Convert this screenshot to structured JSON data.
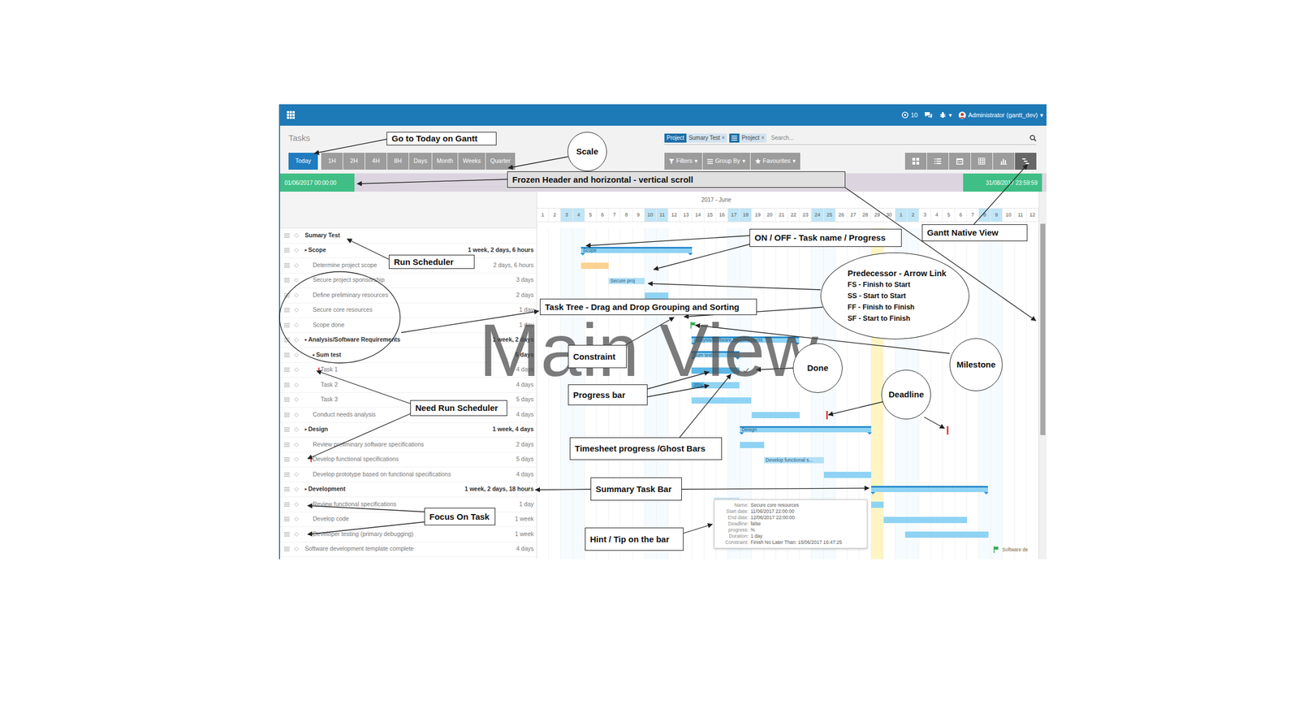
{
  "navbar": {
    "help_count": "10",
    "debug_caret": "▾",
    "user": "Administrator (gantt_dev)",
    "user_caret": "▾"
  },
  "control_panel": {
    "title": "Tasks",
    "facets": [
      {
        "kind": "field",
        "category": "Project",
        "value": "Sumary Test",
        "remove": "×"
      },
      {
        "kind": "groupby",
        "value": "Project",
        "remove": "×"
      }
    ],
    "search": {
      "placeholder": "Search..."
    },
    "today": "Today",
    "scales": [
      {
        "label": "1H",
        "selected": false
      },
      {
        "label": "2H",
        "selected": false
      },
      {
        "label": "4H",
        "selected": false
      },
      {
        "label": "8H",
        "selected": false
      },
      {
        "label": "Days",
        "selected": false
      },
      {
        "label": "Month",
        "selected": false
      },
      {
        "label": "Weeks",
        "selected": false
      },
      {
        "label": "Quarter",
        "selected": false
      }
    ],
    "filters": [
      {
        "kind": "filter",
        "label": "Filters",
        "caret": "▾"
      },
      {
        "kind": "group",
        "label": "Group By",
        "caret": "▾"
      },
      {
        "kind": "favourite",
        "label": "Favourites",
        "caret": "▾"
      }
    ],
    "views": [
      {
        "kind": "kanban",
        "selected": false
      },
      {
        "kind": "list",
        "selected": false
      },
      {
        "kind": "calendar",
        "selected": false
      },
      {
        "kind": "pivot",
        "selected": false
      },
      {
        "kind": "graph",
        "selected": false
      },
      {
        "kind": "gantt",
        "selected": true
      }
    ]
  },
  "range": {
    "start": "01/06/2017 00:00:00",
    "end": "31/08/2017 23:59:59"
  },
  "timeline": {
    "months": [
      {
        "label": "2017 - June",
        "days": [
          {
            "label": "1",
            "weekend": false,
            "today": false
          },
          {
            "label": "2",
            "weekend": false,
            "today": false
          },
          {
            "label": "3",
            "weekend": true,
            "today": false
          },
          {
            "label": "4",
            "weekend": true,
            "today": false
          },
          {
            "label": "5",
            "weekend": false,
            "today": false
          },
          {
            "label": "6",
            "weekend": false,
            "today": false
          },
          {
            "label": "7",
            "weekend": false,
            "today": false
          },
          {
            "label": "8",
            "weekend": false,
            "today": false
          },
          {
            "label": "9",
            "weekend": false,
            "today": false
          },
          {
            "label": "10",
            "weekend": true,
            "today": false
          },
          {
            "label": "11",
            "weekend": true,
            "today": false
          },
          {
            "label": "12",
            "weekend": false,
            "today": false
          },
          {
            "label": "13",
            "weekend": false,
            "today": false
          },
          {
            "label": "14",
            "weekend": false,
            "today": false
          },
          {
            "label": "15",
            "weekend": false,
            "today": false
          },
          {
            "label": "16",
            "weekend": false,
            "today": false
          },
          {
            "label": "17",
            "weekend": true,
            "today": false
          },
          {
            "label": "18",
            "weekend": true,
            "today": false
          },
          {
            "label": "19",
            "weekend": false,
            "today": false
          },
          {
            "label": "20",
            "weekend": false,
            "today": false
          },
          {
            "label": "21",
            "weekend": false,
            "today": false
          },
          {
            "label": "22",
            "weekend": false,
            "today": false
          },
          {
            "label": "23",
            "weekend": false,
            "today": false
          },
          {
            "label": "24",
            "weekend": true,
            "today": false
          },
          {
            "label": "25",
            "weekend": true,
            "today": false
          },
          {
            "label": "26",
            "weekend": false,
            "today": false
          },
          {
            "label": "27",
            "weekend": false,
            "today": false
          },
          {
            "label": "28",
            "weekend": false,
            "today": false
          },
          {
            "label": "29",
            "weekend": false,
            "today": true
          },
          {
            "label": "30",
            "weekend": false,
            "today": false
          }
        ]
      },
      {
        "days": [
          {
            "label": "1",
            "weekend": true,
            "today": false
          },
          {
            "label": "2",
            "weekend": true,
            "today": false
          },
          {
            "label": "3",
            "weekend": false,
            "today": false
          },
          {
            "label": "4",
            "weekend": false,
            "today": false
          },
          {
            "label": "5",
            "weekend": false,
            "today": false
          },
          {
            "label": "6",
            "weekend": false,
            "today": false
          },
          {
            "label": "7",
            "weekend": false,
            "today": false
          },
          {
            "label": "8",
            "weekend": true,
            "today": false
          },
          {
            "label": "9",
            "weekend": true,
            "today": false
          },
          {
            "label": "10",
            "weekend": false,
            "today": false
          },
          {
            "label": "11",
            "weekend": false,
            "today": false
          },
          {
            "label": "12",
            "weekend": false,
            "today": false
          }
        ]
      }
    ]
  },
  "tasks": [
    {
      "name": "Sumary Test",
      "depth": 0,
      "summary": true,
      "needs_scheduler": false,
      "bar": null
    },
    {
      "name": "Scope",
      "depth": 0,
      "summary": true,
      "toggle": "▸",
      "duration": "1 week, 2 days, 6 hours",
      "needs_scheduler": false,
      "bar": {
        "kind": "summary",
        "start": 3.7,
        "span": 9.3,
        "label": "Scope",
        "color": "#8fd3f4",
        "done": false
      }
    },
    {
      "name": "Determine project scope",
      "depth": 1,
      "summary": false,
      "duration": "2 days, 6 hours",
      "needs_scheduler": false,
      "bar": {
        "kind": "task",
        "start": 3.7,
        "span": 2.3,
        "color": "#fbd28f",
        "done": false
      }
    },
    {
      "name": "Secure project sponsorship",
      "depth": 1,
      "summary": false,
      "duration": "3 days",
      "needs_scheduler": false,
      "bar": {
        "kind": "task",
        "start": 6,
        "span": 3,
        "label": "Secure proj",
        "color": "#b3e0f6",
        "done": false
      }
    },
    {
      "name": "Define preliminary resources",
      "depth": 1,
      "summary": false,
      "duration": "2 days",
      "needs_scheduler": false,
      "bar": {
        "kind": "task",
        "start": 9,
        "span": 2,
        "color": "#8fd3f4",
        "done": false
      }
    },
    {
      "name": "Secure core resources",
      "depth": 1,
      "summary": false,
      "duration": "1 day",
      "needs_scheduler": false,
      "bar": {
        "kind": "task",
        "start": 11,
        "span": 1,
        "color": "#f4a3a3",
        "done": false
      }
    },
    {
      "name": "Scope done",
      "depth": 1,
      "summary": false,
      "duration": "1 day",
      "needs_scheduler": false,
      "bar": {
        "kind": "milestone",
        "start": 12.95,
        "color": "#2fa84f",
        "done": false
      }
    },
    {
      "name": "Analysis/Software Requirements",
      "depth": 0,
      "summary": true,
      "toggle": "▸",
      "duration": "1 week, 2 days",
      "needs_scheduler": false,
      "bar": {
        "kind": "summary",
        "start": 12.95,
        "span": 9,
        "label": "Analysis/Software Requirements",
        "color": "#8fd3f4",
        "done": false
      }
    },
    {
      "name": "Sum test",
      "depth": 1,
      "summary": true,
      "toggle": "▸",
      "duration": "5 days",
      "needs_scheduler": false,
      "bar": {
        "kind": "summary",
        "start": 12.95,
        "span": 4,
        "label": "Sum test",
        "color": "#8fd3f4",
        "done": false
      }
    },
    {
      "name": "Task 1",
      "depth": 2,
      "summary": false,
      "duration": "4 days",
      "needs_scheduler": true,
      "bar": {
        "kind": "task",
        "start": 12.95,
        "span": 4,
        "level": 1,
        "color": "#8fd3f4",
        "done": true
      }
    },
    {
      "name": "Task 2",
      "depth": 2,
      "summary": false,
      "duration": "4 days",
      "needs_scheduler": false,
      "bar": {
        "kind": "task",
        "start": 12.95,
        "span": 4,
        "level": 0.25,
        "label": "25%",
        "color": "#8fd3f4",
        "done": false
      }
    },
    {
      "name": "Task 3",
      "depth": 2,
      "summary": false,
      "duration": "5 days",
      "needs_scheduler": false,
      "bar": {
        "kind": "task",
        "start": 12.95,
        "span": 5,
        "color": "#8fd3f4",
        "done": false
      }
    },
    {
      "name": "Conduct needs analysis",
      "depth": 1,
      "summary": false,
      "duration": "4 days",
      "needs_scheduler": false,
      "bar": {
        "kind": "task",
        "start": 18,
        "span": 4,
        "deadline": 24.2,
        "color": "#8fd3f4",
        "done": false
      }
    },
    {
      "name": "Design",
      "depth": 0,
      "summary": true,
      "toggle": "▸",
      "duration": "1 week, 4 days",
      "needs_scheduler": false,
      "bar": {
        "kind": "summary",
        "start": 17,
        "span": 11,
        "label": "Design",
        "deadline": 34.3,
        "color": "#8fd3f4",
        "done": false
      }
    },
    {
      "name": "Review preliminary software specifications",
      "depth": 1,
      "summary": false,
      "duration": "2 days",
      "needs_scheduler": false,
      "bar": {
        "kind": "task",
        "start": 17,
        "span": 2,
        "color": "#8fd3f4",
        "done": false
      }
    },
    {
      "name": "Develop functional specifications",
      "depth": 1,
      "summary": false,
      "duration": "5 days",
      "needs_scheduler": true,
      "bar": {
        "kind": "task",
        "start": 19,
        "span": 5,
        "label": "Develop functional s...",
        "color": "#b3e0f6",
        "done": false
      }
    },
    {
      "name": "Develop prototype based on functional specifications",
      "depth": 1,
      "summary": false,
      "duration": "4 days",
      "needs_scheduler": false,
      "bar": {
        "kind": "task",
        "start": 24,
        "span": 4,
        "color": "#8fd3f4",
        "done": false
      }
    },
    {
      "name": "Development",
      "depth": 0,
      "summary": true,
      "toggle": "▸",
      "duration": "1 week, 2 days, 18 hours",
      "needs_scheduler": false,
      "bar": {
        "kind": "summary",
        "start": 28,
        "span": 9.75,
        "color": "#8fd3f4",
        "done": false
      }
    },
    {
      "name": "Review functional specifications",
      "depth": 1,
      "summary": false,
      "duration": "1 day",
      "needs_scheduler": false,
      "bar": {
        "kind": "task",
        "start": 28,
        "span": 1,
        "ghost": {
          "start": 14.8,
          "span": 2.1
        },
        "color": "#8fd3f4",
        "done": false
      }
    },
    {
      "name": "Develop code",
      "depth": 1,
      "summary": false,
      "duration": "1 week",
      "needs_scheduler": false,
      "bar": {
        "kind": "task",
        "start": 29,
        "span": 7,
        "color": "#8fd3f4",
        "done": false
      }
    },
    {
      "name": "Developer testing (primary debugging)",
      "depth": 1,
      "summary": false,
      "duration": "1 week",
      "needs_scheduler": false,
      "bar": {
        "kind": "task",
        "start": 30.8,
        "span": 7,
        "color": "#8fd3f4",
        "done": false
      }
    },
    {
      "name": "Software development template complete",
      "depth": 0,
      "summary": false,
      "duration": "4 days",
      "needs_scheduler": false,
      "bar": {
        "kind": "milestone",
        "start": 38.3,
        "label": "Software de",
        "color": "#2fa84f",
        "done": false
      }
    }
  ],
  "tooltip": {
    "rows": [
      {
        "label": "Name:",
        "value": "Secure core resources"
      },
      {
        "label": "Start date:",
        "value": "11/06/2017 22:00:00"
      },
      {
        "label": "End date:",
        "value": "12/06/2017 22:00:00"
      },
      {
        "label": "Deadline:",
        "value": "false"
      },
      {
        "label": "progress:",
        "value": "%"
      },
      {
        "label": "Duration:",
        "value": "1 day"
      },
      {
        "label": "Constraint:",
        "value": "Finish No Later Than: 15/06/2017 16:47:25"
      }
    ]
  },
  "watermark": "Main View",
  "annotations": [
    {
      "kind": "box",
      "text": "Go to Today on Gantt"
    },
    {
      "kind": "circle",
      "text": "Scale"
    },
    {
      "kind": "box",
      "text": "Frozen Header and horizontal - vertical scroll"
    },
    {
      "kind": "box",
      "text": "Gantt Native View"
    },
    {
      "kind": "box",
      "text": "ON / OFF - Task name / Progress"
    },
    {
      "kind": "ellipse",
      "text": "Predecessor - Arrow Link",
      "lines": [
        "FS - Finish to Start",
        "SS - Start to Start",
        "FF - Finish to Finish",
        "SF - Start to Finish"
      ]
    },
    {
      "kind": "box",
      "text": "Run Scheduler"
    },
    {
      "kind": "box",
      "text": "Task Tree - Drag and Drop Grouping and Sorting"
    },
    {
      "kind": "box",
      "text": "Constraint"
    },
    {
      "kind": "circle",
      "text": "Done"
    },
    {
      "kind": "circle",
      "text": "Milestone"
    },
    {
      "kind": "circle",
      "text": "Deadline"
    },
    {
      "kind": "box",
      "text": "Progress bar"
    },
    {
      "kind": "box",
      "text": "Need Run Scheduler"
    },
    {
      "kind": "box",
      "text": "Timesheet progress /Ghost Bars"
    },
    {
      "kind": "box",
      "text": "Summary Task Bar"
    },
    {
      "kind": "box",
      "text": "Focus On Task"
    },
    {
      "kind": "box",
      "text": "Hint / Tip on the bar"
    }
  ]
}
